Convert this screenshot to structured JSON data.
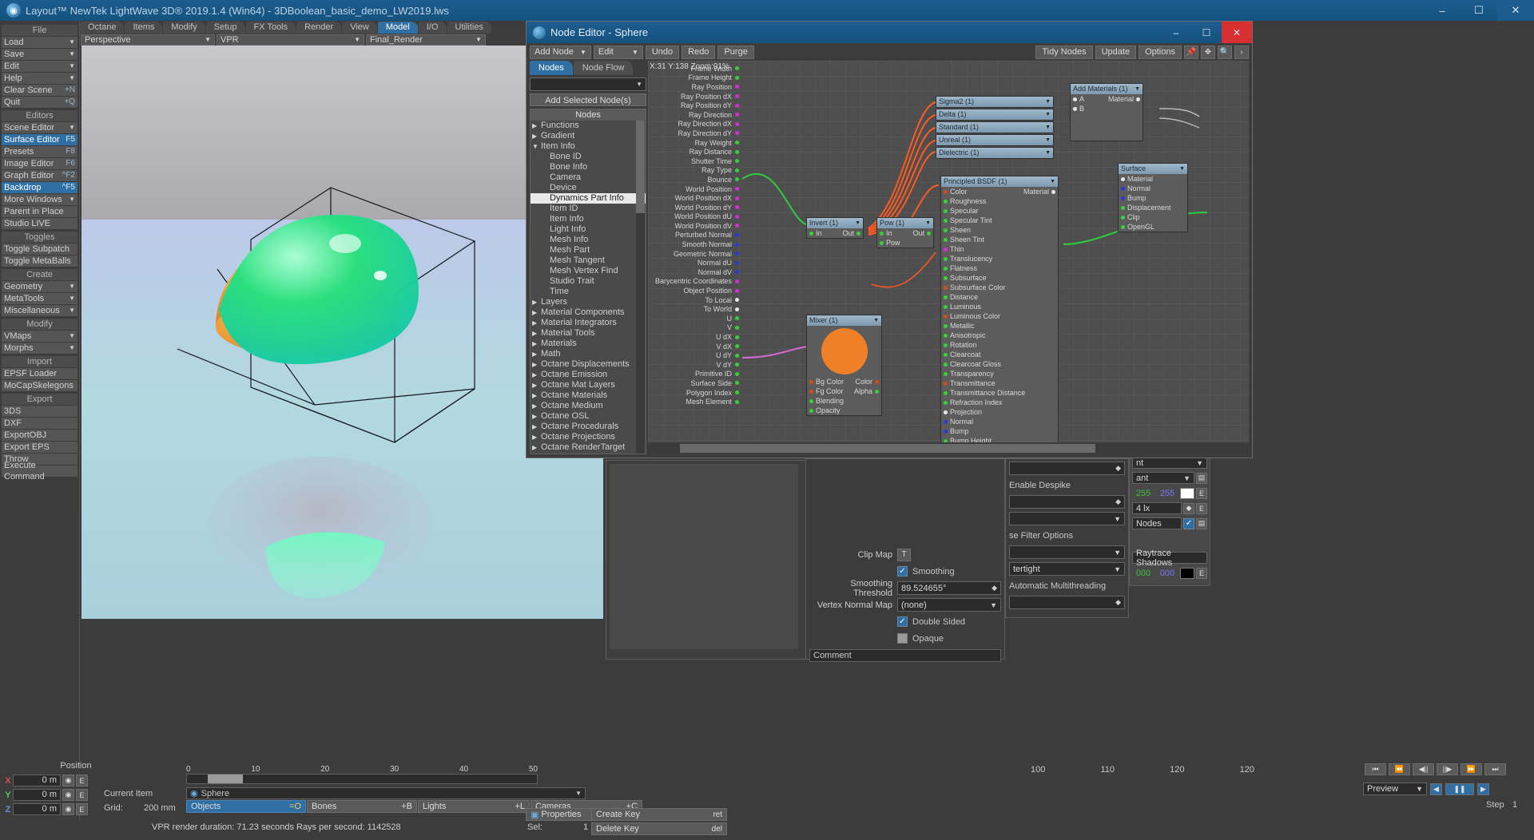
{
  "window": {
    "title": "Layout™ NewTek LightWave 3D® 2019.1.4 (Win64) - 3DBoolean_basic_demo_LW2019.lws",
    "minimize": "–",
    "maximize": "☐",
    "close": "✕"
  },
  "menu_tabs": [
    {
      "label": "Octane",
      "active": false
    },
    {
      "label": "Items",
      "active": false
    },
    {
      "label": "Modify",
      "active": false
    },
    {
      "label": "Setup",
      "active": false
    },
    {
      "label": "FX Tools",
      "active": false
    },
    {
      "label": "Render",
      "active": false
    },
    {
      "label": "View",
      "active": false
    },
    {
      "label": "Model",
      "active": true
    },
    {
      "label": "I/O",
      "active": false
    },
    {
      "label": "Utilities",
      "active": false
    }
  ],
  "sidebar": {
    "groups": [
      {
        "header": "File",
        "items": [
          {
            "label": "Load",
            "chev": true,
            "key": "",
            "hl": false
          },
          {
            "label": "Save",
            "chev": true,
            "key": "",
            "hl": false
          },
          {
            "label": "Edit",
            "chev": true,
            "key": "",
            "hl": false
          },
          {
            "label": "Help",
            "chev": true,
            "key": "",
            "hl": false
          },
          {
            "label": "Clear Scene",
            "chev": false,
            "key": "+N",
            "hl": false
          },
          {
            "label": "Quit",
            "chev": false,
            "key": "+Q",
            "hl": false
          }
        ]
      },
      {
        "header": "Editors",
        "items": [
          {
            "label": "Scene Editor",
            "chev": true,
            "key": "",
            "hl": false
          },
          {
            "label": "Surface Editor",
            "chev": false,
            "key": "F5",
            "hl": true
          },
          {
            "label": "Presets",
            "chev": false,
            "key": "F8",
            "hl": false
          },
          {
            "label": "Image Editor",
            "chev": false,
            "key": "F6",
            "hl": false
          },
          {
            "label": "Graph Editor",
            "chev": false,
            "key": "^F2",
            "hl": false
          },
          {
            "label": "Backdrop",
            "chev": false,
            "key": "^F5",
            "hl": true
          },
          {
            "label": "More Windows",
            "chev": true,
            "key": "",
            "hl": false
          },
          {
            "label": "Parent in Place",
            "chev": false,
            "key": "",
            "hl": false
          },
          {
            "label": "Studio LIVE",
            "chev": false,
            "key": "",
            "hl": false
          }
        ]
      },
      {
        "header": "Toggles",
        "items": [
          {
            "label": "Toggle Subpatch",
            "chev": false,
            "key": "",
            "hl": false
          },
          {
            "label": "Toggle MetaBalls",
            "chev": false,
            "key": "",
            "hl": false
          }
        ]
      },
      {
        "header": "Create",
        "items": [
          {
            "label": "Geometry",
            "chev": true,
            "key": "",
            "hl": false
          },
          {
            "label": "MetaTools",
            "chev": true,
            "key": "",
            "hl": false
          },
          {
            "label": "Miscellaneous",
            "chev": true,
            "key": "",
            "hl": false
          }
        ]
      },
      {
        "header": "Modify",
        "items": [
          {
            "label": "VMaps",
            "chev": true,
            "key": "",
            "hl": false
          },
          {
            "label": "Morphs",
            "chev": true,
            "key": "",
            "hl": false
          }
        ]
      },
      {
        "header": "Import",
        "items": [
          {
            "label": "EPSF Loader",
            "chev": false,
            "key": "",
            "hl": false
          },
          {
            "label": "MoCapSkelegons",
            "chev": false,
            "key": "",
            "hl": false
          }
        ]
      },
      {
        "header": "Export",
        "items": [
          {
            "label": "3DS",
            "chev": false,
            "key": "",
            "hl": false
          },
          {
            "label": "DXF",
            "chev": false,
            "key": "",
            "hl": false
          },
          {
            "label": "ExportOBJ",
            "chev": false,
            "key": "",
            "hl": false
          },
          {
            "label": "Export EPS",
            "chev": false,
            "key": "",
            "hl": false
          },
          {
            "label": "Throw",
            "chev": false,
            "key": "",
            "hl": false
          },
          {
            "label": "Execute Command",
            "chev": false,
            "key": "",
            "hl": false
          }
        ]
      }
    ]
  },
  "viewport_toolbar": {
    "view_mode": "Perspective",
    "render_mode": "VPR",
    "quality": "Final_Render"
  },
  "node_editor": {
    "title": "Node Editor - Sphere",
    "minimize": "–",
    "maximize": "☐",
    "close": "✕",
    "toolbar": {
      "add_node": "Add Node",
      "edit": "Edit",
      "undo": "Undo",
      "redo": "Redo",
      "purge": "Purge",
      "tidy_nodes": "Tidy Nodes",
      "update": "Update",
      "options": "Options",
      "icons": [
        "pin-icon",
        "move-icon",
        "search-icon",
        "chevron-right-icon"
      ]
    },
    "tabs": [
      {
        "label": "Nodes",
        "active": true
      },
      {
        "label": "Node Flow",
        "active": false
      }
    ],
    "search_placeholder": "",
    "add_selected": "Add Selected Node(s)",
    "tree_header": "Nodes",
    "tree": [
      {
        "label": "Functions",
        "type": "group",
        "expanded": false
      },
      {
        "label": "Gradient",
        "type": "group",
        "expanded": false
      },
      {
        "label": "Item Info",
        "type": "group",
        "expanded": true
      },
      {
        "label": "Bone ID",
        "type": "child",
        "selected": false
      },
      {
        "label": "Bone Info",
        "type": "child",
        "selected": false
      },
      {
        "label": "Camera",
        "type": "child",
        "selected": false
      },
      {
        "label": "Device",
        "type": "child",
        "selected": false
      },
      {
        "label": "Dynamics Part Info",
        "type": "child",
        "selected": true
      },
      {
        "label": "Item ID",
        "type": "child",
        "selected": false
      },
      {
        "label": "Item Info",
        "type": "child",
        "selected": false
      },
      {
        "label": "Light Info",
        "type": "child",
        "selected": false
      },
      {
        "label": "Mesh Info",
        "type": "child",
        "selected": false
      },
      {
        "label": "Mesh Part",
        "type": "child",
        "selected": false
      },
      {
        "label": "Mesh Tangent",
        "type": "child",
        "selected": false
      },
      {
        "label": "Mesh Vertex Find",
        "type": "child",
        "selected": false
      },
      {
        "label": "Studio Trait",
        "type": "child",
        "selected": false
      },
      {
        "label": "Time",
        "type": "child",
        "selected": false
      },
      {
        "label": "Layers",
        "type": "group",
        "expanded": false
      },
      {
        "label": "Material Components",
        "type": "group",
        "expanded": false
      },
      {
        "label": "Material Integrators",
        "type": "group",
        "expanded": false
      },
      {
        "label": "Material Tools",
        "type": "group",
        "expanded": false
      },
      {
        "label": "Materials",
        "type": "group",
        "expanded": false
      },
      {
        "label": "Math",
        "type": "group",
        "expanded": false
      },
      {
        "label": "Octane Displacements",
        "type": "group",
        "expanded": false
      },
      {
        "label": "Octane Emission",
        "type": "group",
        "expanded": false
      },
      {
        "label": "Octane Mat Layers",
        "type": "group",
        "expanded": false
      },
      {
        "label": "Octane Materials",
        "type": "group",
        "expanded": false
      },
      {
        "label": "Octane Medium",
        "type": "group",
        "expanded": false
      },
      {
        "label": "Octane OSL",
        "type": "group",
        "expanded": false
      },
      {
        "label": "Octane Procedurals",
        "type": "group",
        "expanded": false
      },
      {
        "label": "Octane Projections",
        "type": "group",
        "expanded": false
      },
      {
        "label": "Octane RenderTarget",
        "type": "group",
        "expanded": false
      }
    ],
    "canvas_info": "X:31 Y:138 Zoom:91%",
    "source_outputs": [
      {
        "label": "Frame Width",
        "color": "g"
      },
      {
        "label": "Frame Height",
        "color": "g"
      },
      {
        "label": "Ray Position",
        "color": "m"
      },
      {
        "label": "Ray Position dX",
        "color": "m"
      },
      {
        "label": "Ray Position dY",
        "color": "m"
      },
      {
        "label": "Ray Direction",
        "color": "m"
      },
      {
        "label": "Ray Direction dX",
        "color": "m"
      },
      {
        "label": "Ray Direction dY",
        "color": "m"
      },
      {
        "label": "Ray Weight",
        "color": "g"
      },
      {
        "label": "Ray Distance",
        "color": "g"
      },
      {
        "label": "Shutter Time",
        "color": "g"
      },
      {
        "label": "Ray Type",
        "color": "g"
      },
      {
        "label": "Bounce",
        "color": "g"
      },
      {
        "label": "World Position",
        "color": "m"
      },
      {
        "label": "World Position dX",
        "color": "m"
      },
      {
        "label": "World Position dY",
        "color": "m"
      },
      {
        "label": "World Position dU",
        "color": "m"
      },
      {
        "label": "World Position dV",
        "color": "m"
      },
      {
        "label": "Perturbed Normal",
        "color": "b"
      },
      {
        "label": "Smooth Normal",
        "color": "b"
      },
      {
        "label": "Geometric Normal",
        "color": "b"
      },
      {
        "label": "Normal dU",
        "color": "b"
      },
      {
        "label": "Normal dV",
        "color": "b"
      },
      {
        "label": "Barycentric Coordinates",
        "color": "m"
      },
      {
        "label": "Object Position",
        "color": "m"
      },
      {
        "label": "To Local",
        "color": "w"
      },
      {
        "label": "To World",
        "color": "w"
      },
      {
        "label": "U",
        "color": "g"
      },
      {
        "label": "V",
        "color": "g"
      },
      {
        "label": "U dX",
        "color": "g"
      },
      {
        "label": "V dX",
        "color": "g"
      },
      {
        "label": "U dY",
        "color": "g"
      },
      {
        "label": "V dY",
        "color": "g"
      },
      {
        "label": "Primitive ID",
        "color": "g"
      },
      {
        "label": "Surface Side",
        "color": "g"
      },
      {
        "label": "Polygon Index",
        "color": "g"
      },
      {
        "label": "Mesh Element",
        "color": "g"
      }
    ],
    "nodes": [
      {
        "id": "invert",
        "title": "Invert (1)",
        "inputs": [
          "In"
        ],
        "outputs": [
          "Out"
        ]
      },
      {
        "id": "pow",
        "title": "Pow (1)",
        "inputs": [
          "In",
          "Pow"
        ],
        "outputs": [
          "Out"
        ]
      },
      {
        "id": "mixer",
        "title": "Mixer (1)",
        "inputs": [
          "Bg Color",
          "Fg Color",
          "Blending",
          "Opacity"
        ],
        "outputs": [
          "Color",
          "Alpha"
        ]
      },
      {
        "id": "sigma2",
        "title": "Sigma2 (1)"
      },
      {
        "id": "delta",
        "title": "Delta (1)"
      },
      {
        "id": "standard",
        "title": "Standard (1)"
      },
      {
        "id": "unreal",
        "title": "Unreal (1)"
      },
      {
        "id": "dielectric",
        "title": "Dielectric (1)"
      },
      {
        "id": "addmaterials",
        "title": "Add Materials (1)",
        "inputs": [
          "A",
          "B"
        ],
        "outputs": [
          "Material"
        ]
      },
      {
        "id": "surface",
        "title": "Surface",
        "inputs": [
          "Material",
          "Normal",
          "Bump",
          "Displacement",
          "Clip",
          "OpenGL"
        ]
      }
    ],
    "principled": {
      "title": "Principled BSDF (1)",
      "output": "Material",
      "inputs": [
        {
          "label": "Color",
          "color": "r"
        },
        {
          "label": "Roughness",
          "color": "g"
        },
        {
          "label": "Specular",
          "color": "g"
        },
        {
          "label": "Specular Tint",
          "color": "g"
        },
        {
          "label": "Sheen",
          "color": "g"
        },
        {
          "label": "Sheen Tint",
          "color": "g"
        },
        {
          "label": "Thin",
          "color": "m"
        },
        {
          "label": "Translucency",
          "color": "g"
        },
        {
          "label": "Flatness",
          "color": "g"
        },
        {
          "label": "Subsurface",
          "color": "g"
        },
        {
          "label": "Subsurface Color",
          "color": "r"
        },
        {
          "label": "Distance",
          "color": "g"
        },
        {
          "label": "Luminous",
          "color": "g"
        },
        {
          "label": "Luminous Color",
          "color": "r"
        },
        {
          "label": "Metallic",
          "color": "g"
        },
        {
          "label": "Anisotropic",
          "color": "g"
        },
        {
          "label": "Rotation",
          "color": "g"
        },
        {
          "label": "Clearcoat",
          "color": "g"
        },
        {
          "label": "Clearcoat Gloss",
          "color": "g"
        },
        {
          "label": "Transparency",
          "color": "g"
        },
        {
          "label": "Transmittance",
          "color": "r"
        },
        {
          "label": "Transmittance Distance",
          "color": "g"
        },
        {
          "label": "Refraction Index",
          "color": "g"
        },
        {
          "label": "Projection",
          "color": "w"
        },
        {
          "label": "Normal",
          "color": "b"
        },
        {
          "label": "Bump",
          "color": "b"
        },
        {
          "label": "Bump Height",
          "color": "g"
        }
      ]
    },
    "mixer_swatch_color": "#f08028"
  },
  "surface_panel": {
    "clip_map_label": "Clip Map",
    "clip_map_button": "T",
    "smoothing_label": "Smoothing",
    "smoothing_checked": true,
    "smoothing_threshold_label": "Smoothing Threshold",
    "smoothing_threshold_value": "89.524655°",
    "vertex_normal_map_label": "Vertex Normal Map",
    "vertex_normal_map_value": "(none)",
    "double_sided_label": "Double Sided",
    "double_sided_checked": true,
    "opaque_label": "Opaque",
    "opaque_checked": false,
    "comment_label": "Comment"
  },
  "mid_panel": {
    "enable_despike": "Enable Despike",
    "filter_options": "se Filter Options",
    "watertight": "tertight",
    "automatic_multithreading": "Automatic Multithreading"
  },
  "right_panel": {
    "top_value": "nt",
    "second_value": "ant",
    "color_r": "255",
    "color_b": "255",
    "lux_value": "4 lx",
    "nodes_label": "Nodes",
    "nodes_checked": true,
    "raytrace_shadows": "Raytrace Shadows",
    "shadow_r": "000",
    "shadow_b": "000",
    "e_button": "E"
  },
  "bottom": {
    "position_label": "Position",
    "axes": [
      {
        "axis": "X",
        "value": "0 m",
        "e": "E"
      },
      {
        "axis": "Y",
        "value": "0 m",
        "e": "E"
      },
      {
        "axis": "Z",
        "value": "0 m",
        "e": "E"
      }
    ],
    "grid_label": "Grid:",
    "grid_value": "200 mm",
    "current_item_label": "Current Item",
    "current_item_value": "Sphere",
    "objects_tab": "Objects",
    "objects_key": "=O",
    "bones_tab": "Bones",
    "bones_key": "+B",
    "lights_tab": "Lights",
    "lights_key": "+L",
    "cameras_tab": "Cameras",
    "cameras_key": "+C",
    "vpr_status": "VPR render duration: 71.23 seconds  Rays per second: 1142528",
    "properties_tab": "Properties",
    "sel_label": "Sel:",
    "sel_value": "1",
    "create_key": "Create Key",
    "create_key_hint": "ret",
    "delete_key": "Delete Key",
    "delete_key_hint": "del",
    "timeline_start": "0",
    "timeline_ticks": [
      "10",
      "20",
      "30",
      "40",
      "50"
    ],
    "frame_field": "0",
    "right_ticks": [
      "100",
      "110",
      "120",
      "120"
    ],
    "preview_label": "Preview",
    "step_label": "Step",
    "step_value": "1",
    "transport": [
      "⏮",
      "⏪",
      "◀||",
      "||▶",
      "⏩",
      "⏭"
    ]
  }
}
